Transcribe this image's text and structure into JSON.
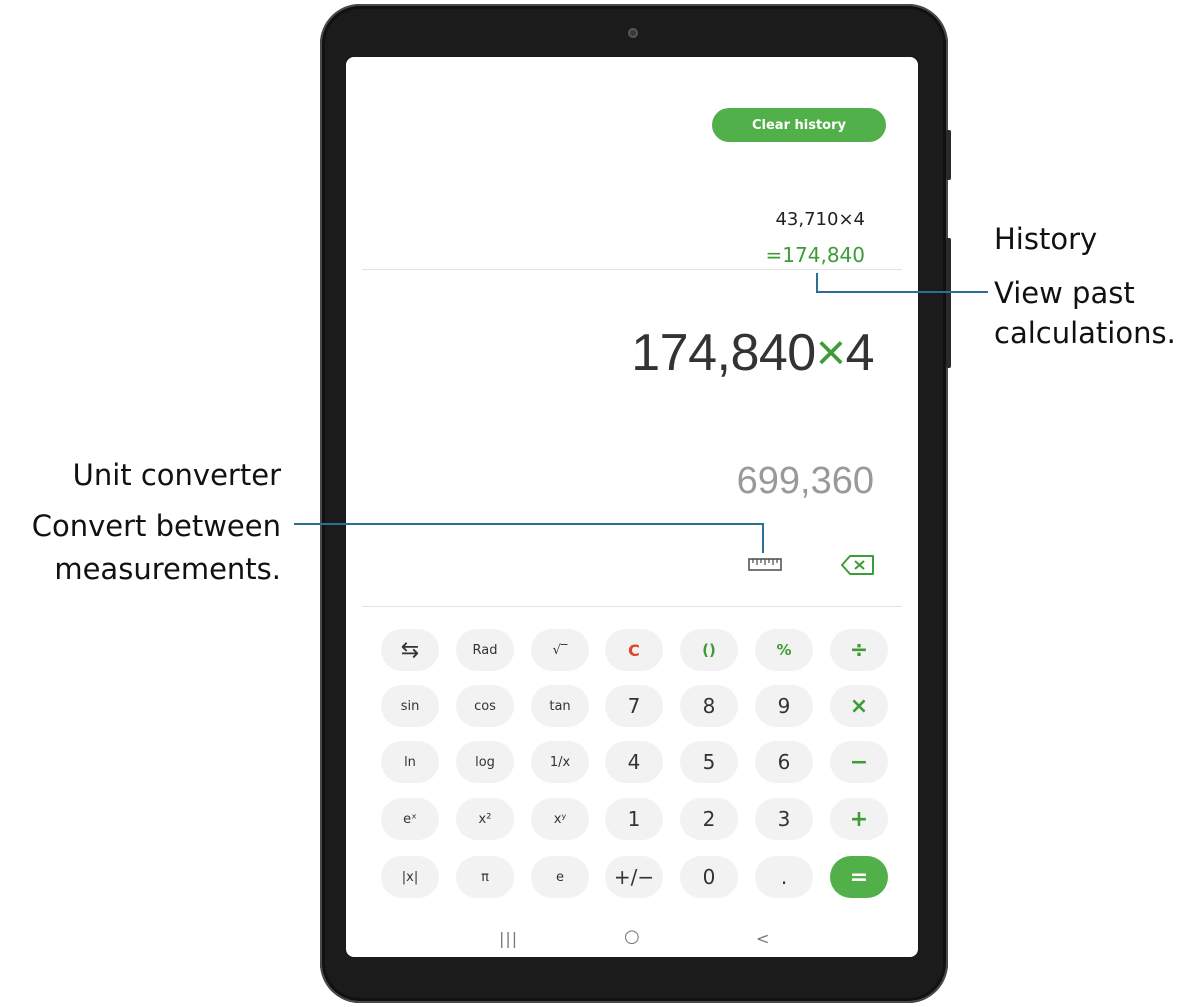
{
  "history": {
    "clear_label": "Clear history",
    "expression": "43,710×4",
    "result": "=174,840"
  },
  "display": {
    "number": "174,840",
    "operator": "×",
    "operand": "4",
    "preview": "699,360"
  },
  "tools": {
    "unit_converter_icon": "ruler-icon",
    "backspace_icon": "backspace-icon"
  },
  "keypad": {
    "row1": [
      "⇆",
      "Rad",
      "√‾",
      "C",
      "()",
      "%",
      "÷"
    ],
    "row2": [
      "sin",
      "cos",
      "tan",
      "7",
      "8",
      "9",
      "×"
    ],
    "row3": [
      "ln",
      "log",
      "1/x",
      "4",
      "5",
      "6",
      "−"
    ],
    "row4": [
      "eˣ",
      "x²",
      "xʸ",
      "1",
      "2",
      "3",
      "+"
    ],
    "row5": [
      "|x|",
      "π",
      "e",
      "+/−",
      "0",
      ".",
      "="
    ]
  },
  "nav": {
    "recent": "|||",
    "home": "○",
    "back": "<"
  },
  "callouts": {
    "history_title": "History",
    "history_desc_1": "View past",
    "history_desc_2": "calculations.",
    "unit_title": "Unit converter",
    "unit_desc_1": "Convert between",
    "unit_desc_2": "measurements."
  },
  "colors": {
    "accent_green": "#52b04a",
    "clear_red": "#e0452c",
    "callout_line": "#2e6e96"
  }
}
